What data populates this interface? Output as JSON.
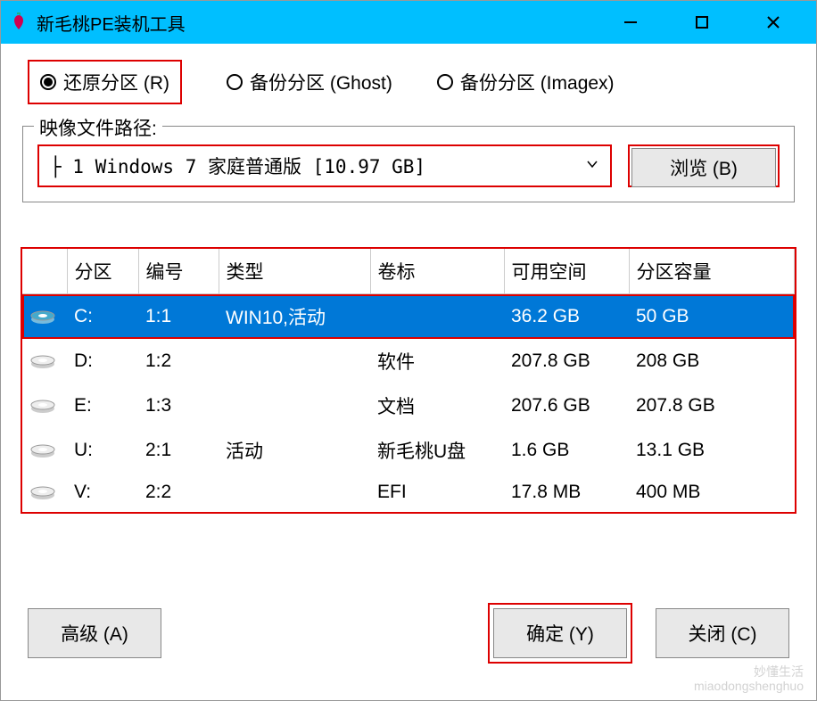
{
  "window": {
    "title": "新毛桃PE装机工具"
  },
  "radios": {
    "restore": "还原分区 (R)",
    "backup_ghost": "备份分区 (Ghost)",
    "backup_imagex": "备份分区 (Imagex)"
  },
  "image_path": {
    "legend": "映像文件路径:",
    "selected": "├ 1 Windows 7 家庭普通版 [10.97 GB]",
    "browse": "浏览 (B)"
  },
  "table": {
    "headers": {
      "partition": "分区",
      "number": "编号",
      "type": "类型",
      "label": "卷标",
      "free": "可用空间",
      "capacity": "分区容量"
    },
    "rows": [
      {
        "part": "C:",
        "num": "1:1",
        "type": "WIN10,活动",
        "label": "",
        "free": "36.2 GB",
        "cap": "50 GB",
        "selected": true
      },
      {
        "part": "D:",
        "num": "1:2",
        "type": "",
        "label": "软件",
        "free": "207.8 GB",
        "cap": "208 GB",
        "selected": false
      },
      {
        "part": "E:",
        "num": "1:3",
        "type": "",
        "label": "文档",
        "free": "207.6 GB",
        "cap": "207.8 GB",
        "selected": false
      },
      {
        "part": "U:",
        "num": "2:1",
        "type": "活动",
        "label": "新毛桃U盘",
        "free": "1.6 GB",
        "cap": "13.1 GB",
        "selected": false
      },
      {
        "part": "V:",
        "num": "2:2",
        "type": "",
        "label": "EFI",
        "free": "17.8 MB",
        "cap": "400 MB",
        "selected": false
      }
    ]
  },
  "buttons": {
    "advanced": "高级 (A)",
    "ok": "确定 (Y)",
    "close": "关闭 (C)"
  },
  "watermark": {
    "line1": "妙懂生活",
    "line2": "miaodongshenghuo"
  }
}
